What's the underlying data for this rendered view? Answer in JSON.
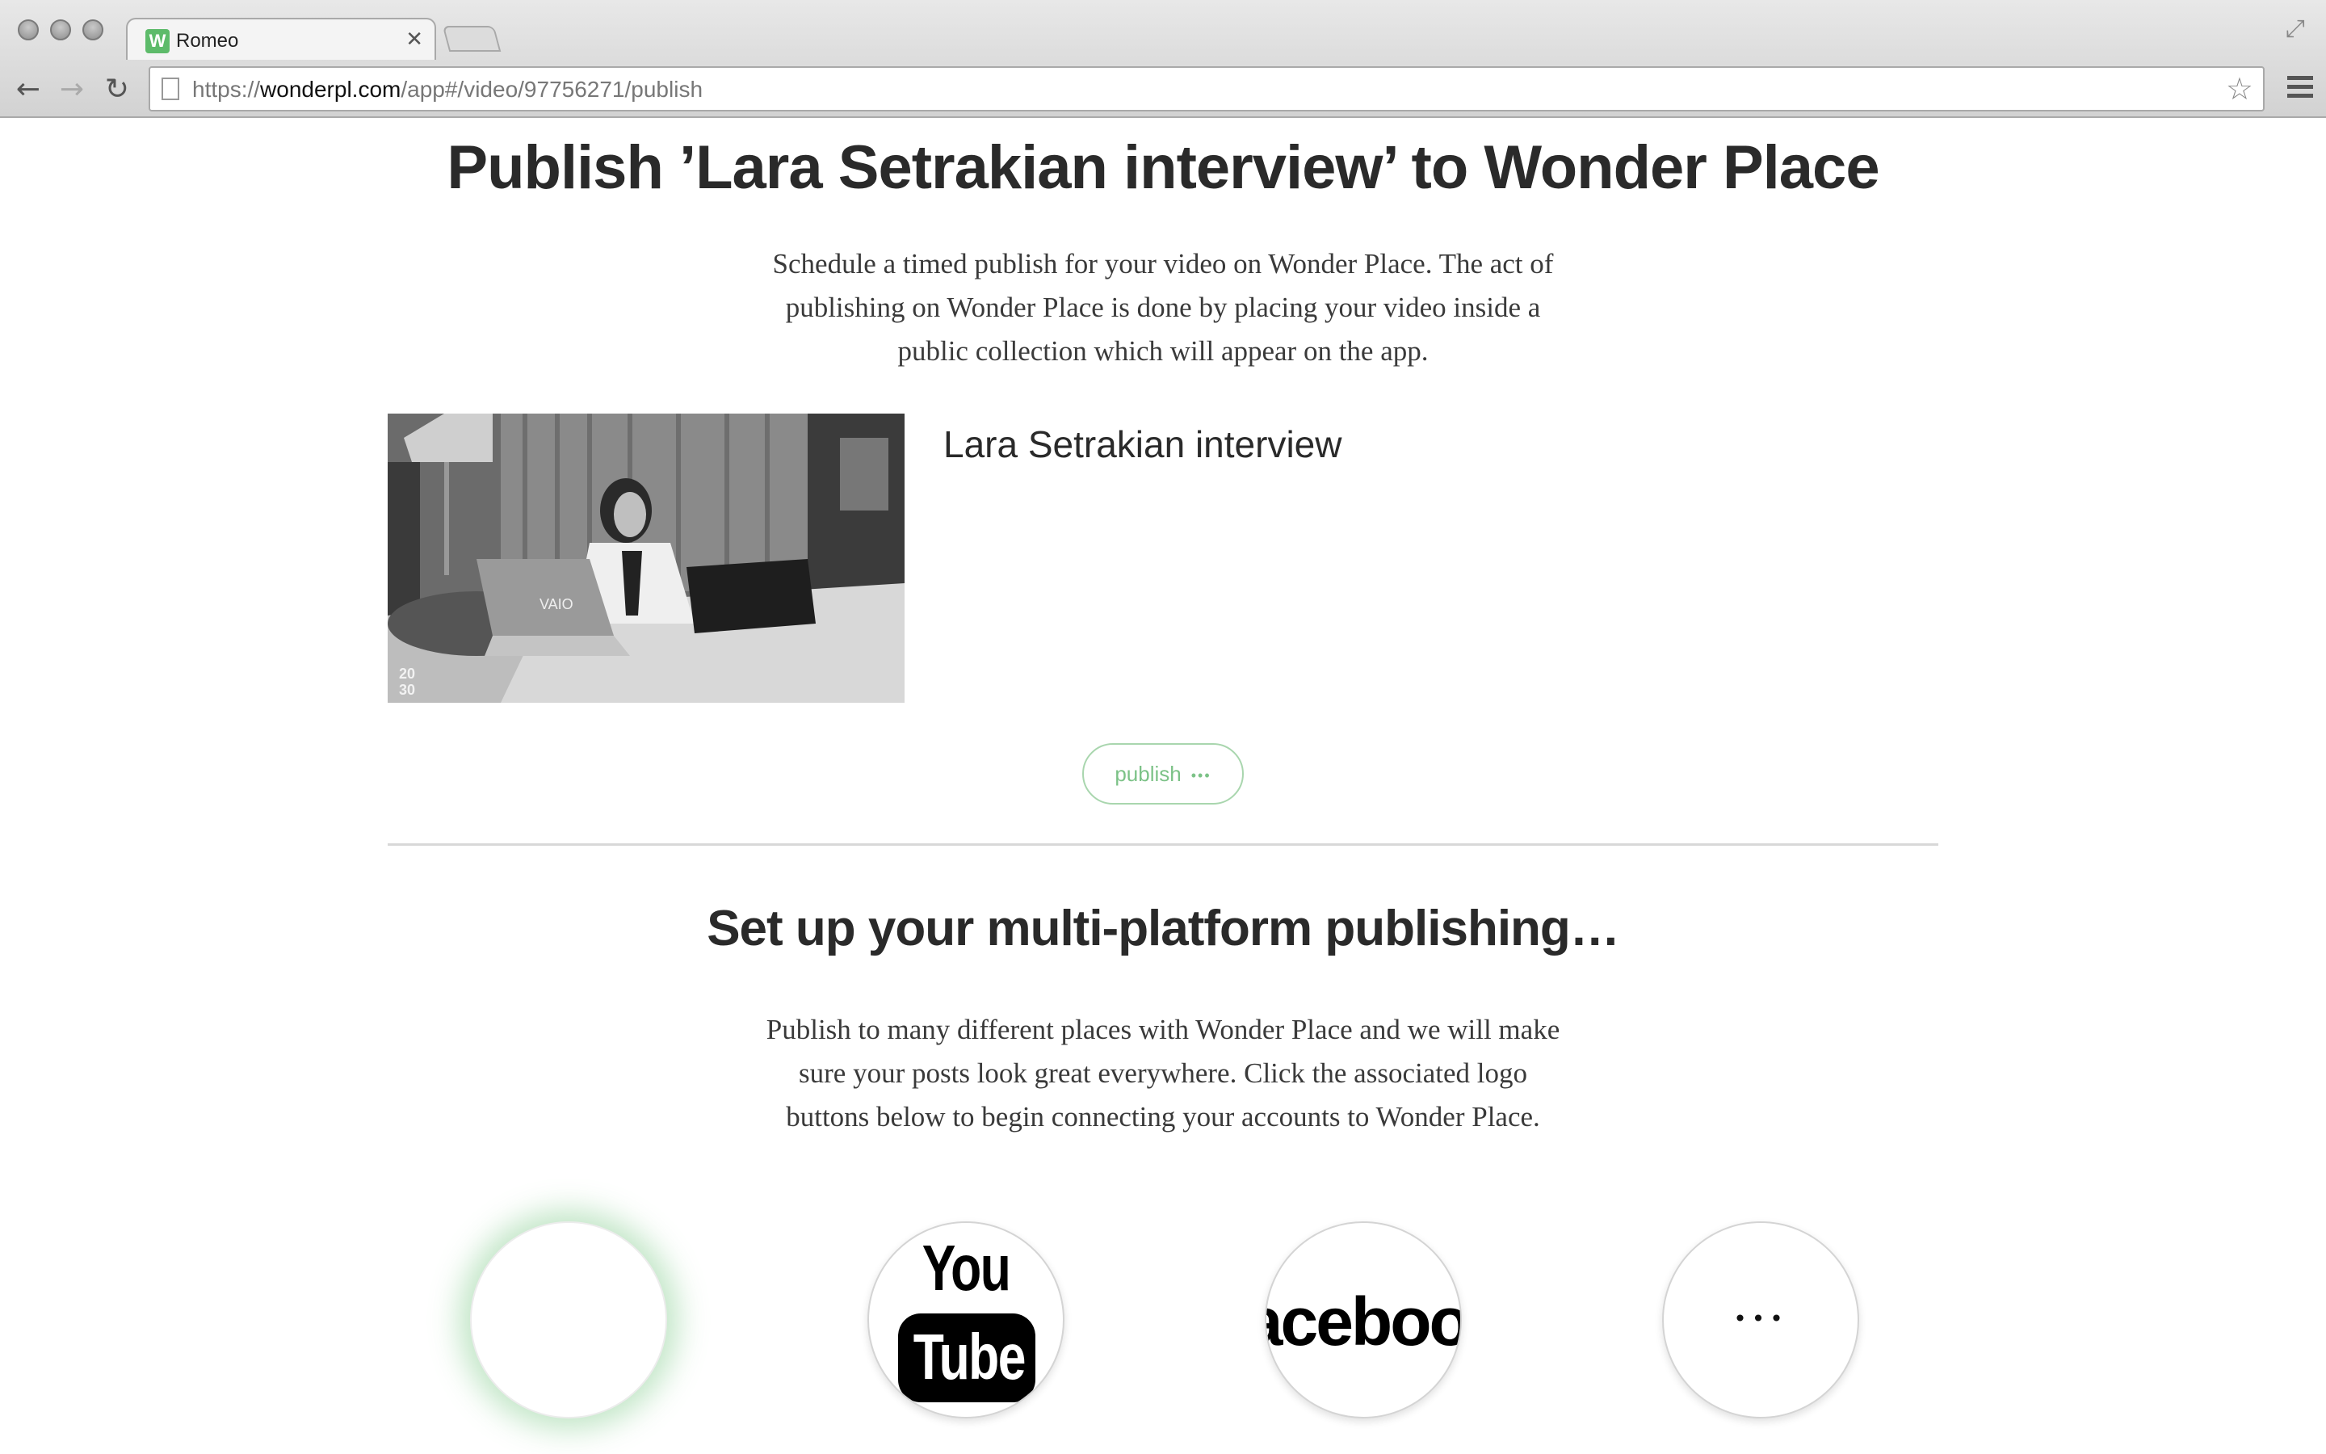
{
  "browser": {
    "tab_title": "Romeo",
    "tab_favicon_letter": "W",
    "url_prefix": "https://",
    "url_host": "wonderpl.com",
    "url_path": "/app#/video/97756271/publish",
    "icons": {
      "back": "back-arrow-icon",
      "forward": "forward-arrow-icon",
      "reload": "reload-icon",
      "star": "bookmark-star-icon",
      "menu": "hamburger-menu-icon",
      "close": "close-icon",
      "fullscreen": "fullscreen-icon"
    }
  },
  "publish_section": {
    "heading": "Publish ’Lara Setrakian interview’ to Wonder Place",
    "description": "Schedule a timed publish for your video on Wonder Place. The act of publishing on Wonder Place is done by placing your video inside a public collection which will appear on the app.",
    "video": {
      "title": "Lara Setrakian interview",
      "thumbnail_mark": "20 30"
    },
    "publish_button_label": "publish",
    "publish_button_dots": "•••"
  },
  "multiplatform_section": {
    "heading": "Set up your multi-platform publishing…",
    "description": "Publish to many different places with Wonder Place and we will make sure your posts look great everywhere. Click the associated logo buttons below to begin connecting your accounts to Wonder Place.",
    "platforms": [
      {
        "id": "wonder-place",
        "label": "",
        "selected": true
      },
      {
        "id": "youtube",
        "label_top": "You",
        "label_bottom": "Tube",
        "selected": false
      },
      {
        "id": "facebook",
        "label": "acebool",
        "selected": false
      },
      {
        "id": "more",
        "label": "•••",
        "selected": false
      }
    ]
  },
  "colors": {
    "accent_green": "#7cc287",
    "favicon_green": "#5dbb6a",
    "heading_text": "#2a2a2a",
    "body_text": "#3a3a3a"
  }
}
